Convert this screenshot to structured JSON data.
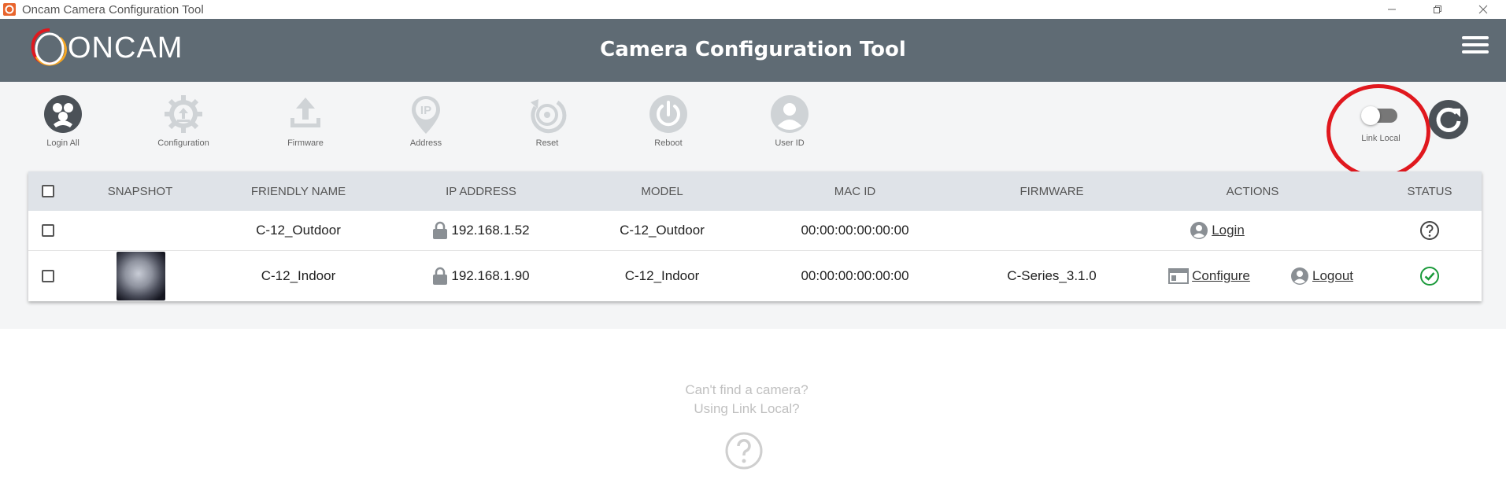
{
  "window": {
    "title": "Oncam Camera Configuration Tool"
  },
  "header": {
    "logo_text": "ONCAM",
    "title": "Camera Configuration Tool",
    "colors": {
      "header_bg": "#5f6b74",
      "accent": "#e0181e"
    }
  },
  "toolbar": {
    "items": [
      {
        "label": "Login All",
        "icon": "login-all-icon",
        "enabled": true
      },
      {
        "label": "Configuration",
        "icon": "gear-upload-icon",
        "enabled": false
      },
      {
        "label": "Firmware",
        "icon": "upload-icon",
        "enabled": false
      },
      {
        "label": "Address",
        "icon": "ip-pin-icon",
        "enabled": false
      },
      {
        "label": "Reset",
        "icon": "reset-icon",
        "enabled": false
      },
      {
        "label": "Reboot",
        "icon": "power-icon",
        "enabled": false
      },
      {
        "label": "User ID",
        "icon": "user-icon",
        "enabled": false
      }
    ],
    "link_local_label": "Link Local",
    "link_local_on": false
  },
  "table": {
    "headers": {
      "snapshot": "SNAPSHOT",
      "friendly_name": "FRIENDLY NAME",
      "ip_address": "IP ADDRESS",
      "model": "MODEL",
      "mac_id": "MAC ID",
      "firmware": "FIRMWARE",
      "actions": "ACTIONS",
      "status": "STATUS"
    },
    "rows": [
      {
        "friendly_name": "C-12_Outdoor",
        "ip_address": "192.168.1.52",
        "model": "C-12_Outdoor",
        "mac_id": "00:00:00:00:00:00",
        "firmware": "",
        "login_label": " Login",
        "status": "unknown"
      },
      {
        "friendly_name": "C-12_Indoor",
        "ip_address": "192.168.1.90",
        "model": "C-12_Indoor",
        "mac_id": "00:00:00:00:00:00",
        "firmware": "C-Series_3.1.0",
        "configure_label": " Configure",
        "logout_label": " Logout",
        "status": "ok"
      }
    ]
  },
  "help": {
    "line1": "Can't find a camera?",
    "line2": "Using Link Local?"
  }
}
